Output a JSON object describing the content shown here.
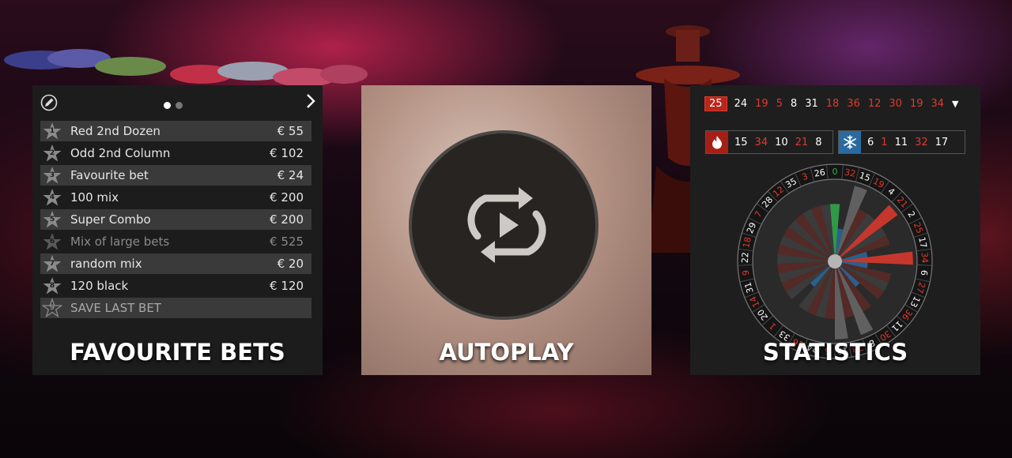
{
  "favourite_bets": {
    "title": "FAVOURITE BETS",
    "bets": [
      {
        "rank": "1",
        "name": "Red 2nd Dozen",
        "amount": "€ 55"
      },
      {
        "rank": "2",
        "name": "Odd 2nd Column",
        "amount": "€ 102"
      },
      {
        "rank": "3",
        "name": "Favourite bet",
        "amount": "€ 24"
      },
      {
        "rank": "4",
        "name": "100 mix",
        "amount": "€ 200"
      },
      {
        "rank": "5",
        "name": "Super Combo",
        "amount": "€ 200"
      },
      {
        "rank": "6",
        "name": "Mix of large bets",
        "amount": "€ 525"
      },
      {
        "rank": "7",
        "name": "random mix",
        "amount": "€ 20"
      },
      {
        "rank": "8",
        "name": "120 black",
        "amount": "€ 120"
      },
      {
        "rank": "9",
        "name": "SAVE LAST BET",
        "amount": ""
      }
    ]
  },
  "autoplay": {
    "title": "AUTOPLAY"
  },
  "statistics": {
    "title": "STATISTICS",
    "last_numbers": [
      {
        "n": "25",
        "c": "red"
      },
      {
        "n": "24",
        "c": "black"
      },
      {
        "n": "19",
        "c": "red"
      },
      {
        "n": "5",
        "c": "red"
      },
      {
        "n": "8",
        "c": "black"
      },
      {
        "n": "31",
        "c": "black"
      },
      {
        "n": "18",
        "c": "red"
      },
      {
        "n": "36",
        "c": "red"
      },
      {
        "n": "12",
        "c": "red"
      },
      {
        "n": "30",
        "c": "red"
      },
      {
        "n": "19",
        "c": "red"
      },
      {
        "n": "34",
        "c": "red"
      }
    ],
    "hot_numbers": [
      {
        "n": "15",
        "c": "black"
      },
      {
        "n": "34",
        "c": "red"
      },
      {
        "n": "10",
        "c": "black"
      },
      {
        "n": "21",
        "c": "red"
      },
      {
        "n": "8",
        "c": "black"
      }
    ],
    "cold_numbers": [
      {
        "n": "6",
        "c": "black"
      },
      {
        "n": "1",
        "c": "red"
      },
      {
        "n": "11",
        "c": "black"
      },
      {
        "n": "32",
        "c": "red"
      },
      {
        "n": "17",
        "c": "black"
      }
    ],
    "wheel_numbers": [
      "0",
      "32",
      "15",
      "19",
      "4",
      "21",
      "2",
      "25",
      "17",
      "34",
      "6",
      "27",
      "13",
      "36",
      "11",
      "30",
      "8",
      "23",
      "10",
      "5",
      "24",
      "16",
      "33",
      "1",
      "20",
      "14",
      "31",
      "9",
      "22",
      "18",
      "29",
      "7",
      "28",
      "12",
      "35",
      "3",
      "26"
    ],
    "red_numbers": [
      "1",
      "3",
      "5",
      "7",
      "9",
      "12",
      "14",
      "16",
      "18",
      "19",
      "21",
      "23",
      "25",
      "27",
      "30",
      "32",
      "34",
      "36"
    ]
  },
  "colors": {
    "red": "#e03a2e",
    "green": "#2fae4c",
    "cold_blue": "#2a6aa0",
    "hot_red": "#a51f16"
  }
}
